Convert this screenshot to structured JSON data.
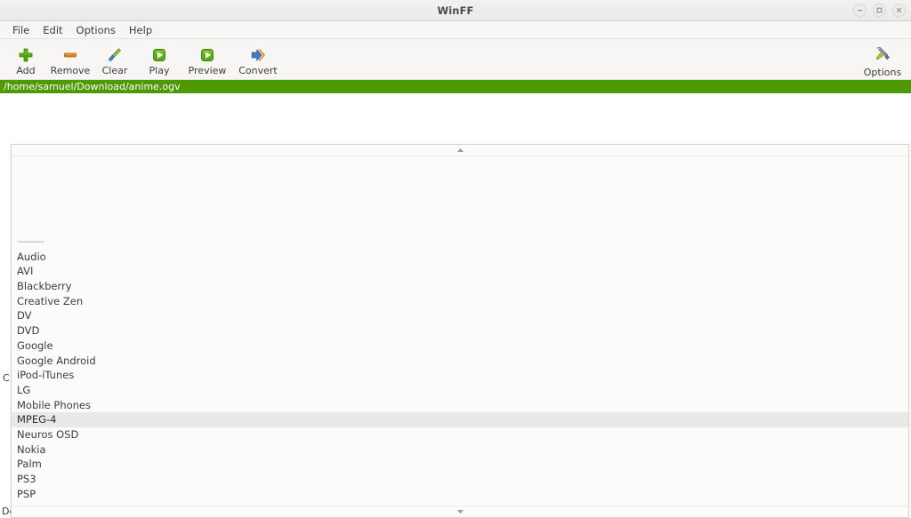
{
  "window": {
    "title": "WinFF",
    "controls": [
      {
        "name": "minimize",
        "glyph": "minimize-icon"
      },
      {
        "name": "maximize",
        "glyph": "maximize-icon"
      },
      {
        "name": "close",
        "glyph": "close-icon"
      }
    ]
  },
  "menubar": {
    "items": [
      {
        "label": "File"
      },
      {
        "label": "Edit"
      },
      {
        "label": "Options"
      },
      {
        "label": "Help"
      }
    ]
  },
  "toolbar": {
    "buttons": [
      {
        "label": "Add",
        "icon": "plus-icon"
      },
      {
        "label": "Remove",
        "icon": "minus-icon"
      },
      {
        "label": "Clear",
        "icon": "broom-icon"
      },
      {
        "label": "Play",
        "icon": "play-icon"
      },
      {
        "label": "Preview",
        "icon": "preview-icon"
      },
      {
        "label": "Convert",
        "icon": "convert-arrows-icon"
      }
    ],
    "options": {
      "label": "Options",
      "icon": "tools-icon"
    }
  },
  "filelist": {
    "selected_file": "/home/samuel/Download/anime.ogv"
  },
  "form": {
    "convert_to_label": "C",
    "device_label": "De"
  },
  "dropdown": {
    "scroll_up": "scroll-up-arrow",
    "scroll_down": "scroll-down-arrow",
    "selected": "MPEG-4",
    "items": [
      {
        "label": "———",
        "separator": true
      },
      {
        "label": "Audio"
      },
      {
        "label": "AVI"
      },
      {
        "label": "Blackberry"
      },
      {
        "label": "Creative Zen"
      },
      {
        "label": "DV"
      },
      {
        "label": "DVD"
      },
      {
        "label": "Google"
      },
      {
        "label": "Google Android"
      },
      {
        "label": "iPod-iTunes"
      },
      {
        "label": "LG"
      },
      {
        "label": "Mobile Phones"
      },
      {
        "label": "MPEG-4"
      },
      {
        "label": "Neuros OSD"
      },
      {
        "label": "Nokia"
      },
      {
        "label": "Palm"
      },
      {
        "label": "PS3"
      },
      {
        "label": "PSP"
      }
    ]
  },
  "colors": {
    "selection_green": "#4e9a06",
    "toolbar_bg": "#f7f6f5",
    "highlight_gray": "#e9e9e7"
  }
}
